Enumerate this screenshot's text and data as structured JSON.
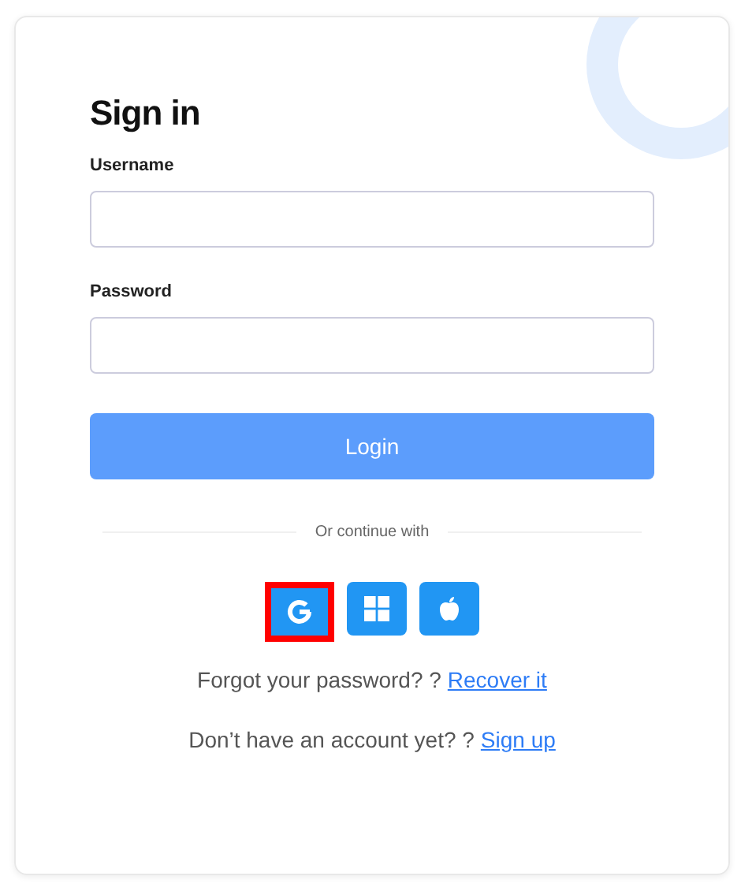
{
  "title": "Sign in",
  "fields": [
    {
      "label": "Username"
    },
    {
      "label": "Password"
    }
  ],
  "login_button": "Login",
  "divider": "Or continue with",
  "social_buttons": [
    {
      "kind": "google",
      "selected": true
    },
    {
      "kind": "windows",
      "selected": false
    },
    {
      "kind": "apple",
      "selected": false
    }
  ],
  "links": [
    {
      "text": "Forgot your password? ?",
      "link": "Recover it"
    },
    {
      "text": "Don’t have an account yet? ?",
      "link": "Sign up"
    }
  ]
}
